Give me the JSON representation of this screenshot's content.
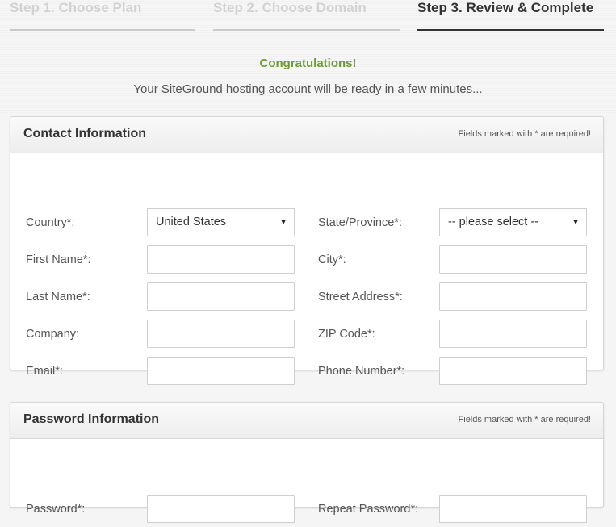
{
  "steps": [
    {
      "label": "Step 1. Choose Plan",
      "active": false
    },
    {
      "label": "Step 2. Choose Domain",
      "active": false
    },
    {
      "label": "Step 3. Review & Complete",
      "active": true
    }
  ],
  "message": {
    "title": "Congratulations!",
    "subtitle": "Your SiteGround hosting account will be ready in a few minutes..."
  },
  "contact": {
    "title": "Contact Information",
    "note": "Fields marked with * are required!",
    "country_label": "Country*:",
    "country_value": "United States",
    "state_label": "State/Province*:",
    "state_value": "-- please select --",
    "first_name_label": "First Name*:",
    "city_label": "City*:",
    "last_name_label": "Last Name*:",
    "street_label": "Street Address*:",
    "company_label": "Company:",
    "zip_label": "ZIP Code*:",
    "email_label": "Email*:",
    "phone_label": "Phone Number*:"
  },
  "password": {
    "title": "Password Information",
    "note": "Fields marked with * are required!",
    "password_label": "Password*:",
    "repeat_label": "Repeat Password*:"
  },
  "icons": {
    "dropdown": "triangle-down"
  },
  "colors": {
    "accent_green": "#6e9a33",
    "active_step": "#333333",
    "inactive_step": "#d2d2d2"
  }
}
